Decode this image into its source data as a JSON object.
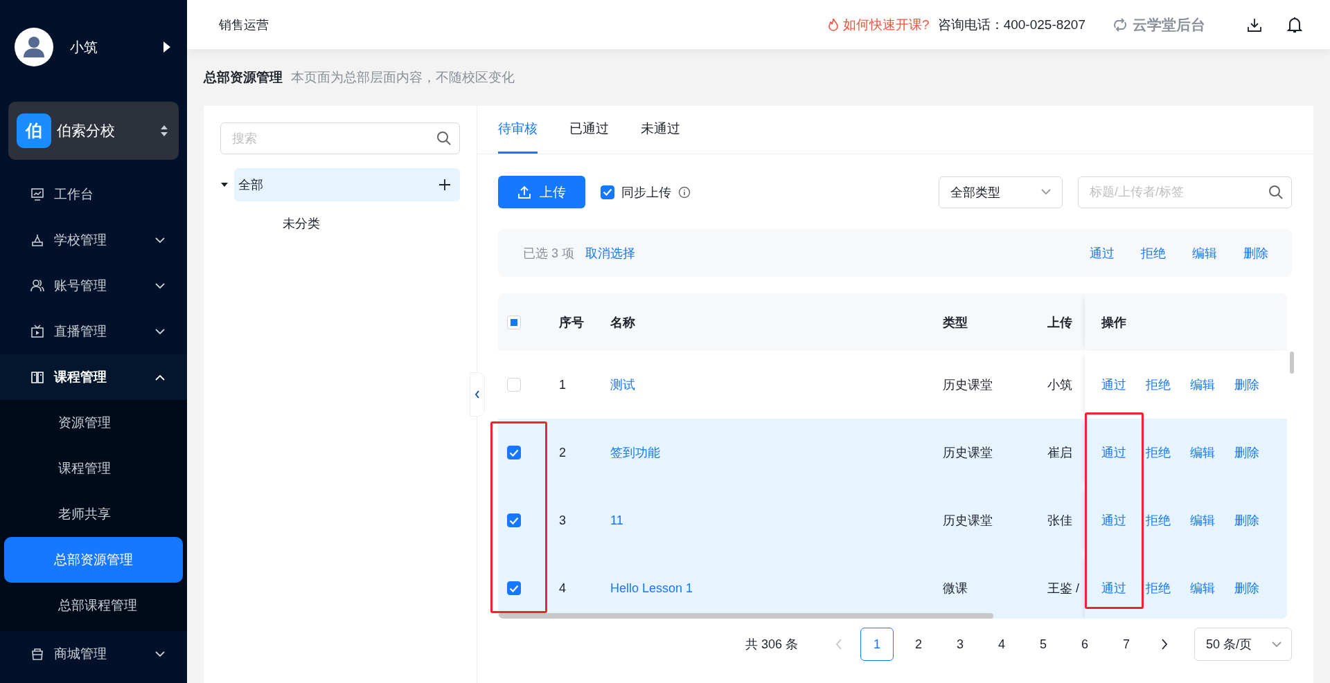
{
  "topbar": {
    "title": "销售运营",
    "help_link": "如何快速开课?",
    "phone": "咨询电话：400-025-8207",
    "brand": "云学堂后台"
  },
  "sidebar": {
    "user": {
      "name": "小筑"
    },
    "school": {
      "badge": "伯",
      "name": "伯索分校"
    },
    "menu": [
      {
        "kind": "link",
        "label": "工作台"
      },
      {
        "kind": "group",
        "label": "学校管理",
        "expanded": false
      },
      {
        "kind": "group",
        "label": "账号管理",
        "expanded": false
      },
      {
        "kind": "group",
        "label": "直播管理",
        "expanded": false
      },
      {
        "kind": "group",
        "label": "课程管理",
        "expanded": true,
        "children": [
          {
            "label": "资源管理",
            "selected": false
          },
          {
            "label": "课程管理",
            "selected": false
          },
          {
            "label": "老师共享",
            "selected": false
          },
          {
            "label": "总部资源管理",
            "selected": true
          },
          {
            "label": "总部课程管理",
            "selected": false
          }
        ]
      },
      {
        "kind": "group",
        "label": "商城管理",
        "expanded": false
      }
    ]
  },
  "page": {
    "title": "总部资源管理",
    "note": "本页面为总部层面内容，不随校区变化"
  },
  "tree": {
    "search": {
      "placeholder": "搜索"
    },
    "nodes": [
      {
        "label": "全部",
        "expanded": true,
        "selected": true,
        "children": [
          {
            "label": "未分类",
            "selected": false
          }
        ]
      }
    ]
  },
  "tabs": [
    {
      "label": "待审核",
      "selected": true
    },
    {
      "label": "已通过",
      "selected": false
    },
    {
      "label": "未通过",
      "selected": false
    }
  ],
  "toolbar": {
    "upload": "上传",
    "sync": {
      "label": "同步上传",
      "checked": true
    },
    "type_select": "全部类型",
    "search": {
      "placeholder": "标题/上传者/标签"
    }
  },
  "selection_bar": {
    "count": "已选 3 项",
    "clear": "取消选择",
    "actions": [
      "通过",
      "拒绝",
      "编辑",
      "删除"
    ]
  },
  "table": {
    "select_all_indeterminate": true,
    "columns": [
      "序号",
      "名称",
      "类型",
      "上传",
      "操作"
    ],
    "rows": [
      {
        "selected": false,
        "no": "1",
        "name": "测试",
        "type": "历史课堂",
        "uploader": "小筑",
        "actions": [
          "通过",
          "拒绝",
          "编辑",
          "删除"
        ]
      },
      {
        "selected": true,
        "no": "2",
        "name": "签到功能",
        "type": "历史课堂",
        "uploader": "崔启",
        "actions": [
          "通过",
          "拒绝",
          "编辑",
          "删除"
        ]
      },
      {
        "selected": true,
        "no": "3",
        "name": "11",
        "type": "历史课堂",
        "uploader": "张佳",
        "actions": [
          "通过",
          "拒绝",
          "编辑",
          "删除"
        ]
      },
      {
        "selected": true,
        "no": "4",
        "name": "Hello Lesson 1",
        "type": "微课",
        "uploader": "王鉴 /",
        "actions": [
          "通过",
          "拒绝",
          "编辑",
          "删除"
        ]
      }
    ],
    "annotation_frames": true
  },
  "pagination": {
    "total": "共 306 条",
    "pages": [
      {
        "label": "1",
        "selected": true
      },
      {
        "label": "2",
        "selected": false
      },
      {
        "label": "3",
        "selected": false
      },
      {
        "label": "4",
        "selected": false
      },
      {
        "label": "5",
        "selected": false
      },
      {
        "label": "6",
        "selected": false
      },
      {
        "label": "7",
        "selected": false
      }
    ],
    "page_size": "50 条/页"
  }
}
